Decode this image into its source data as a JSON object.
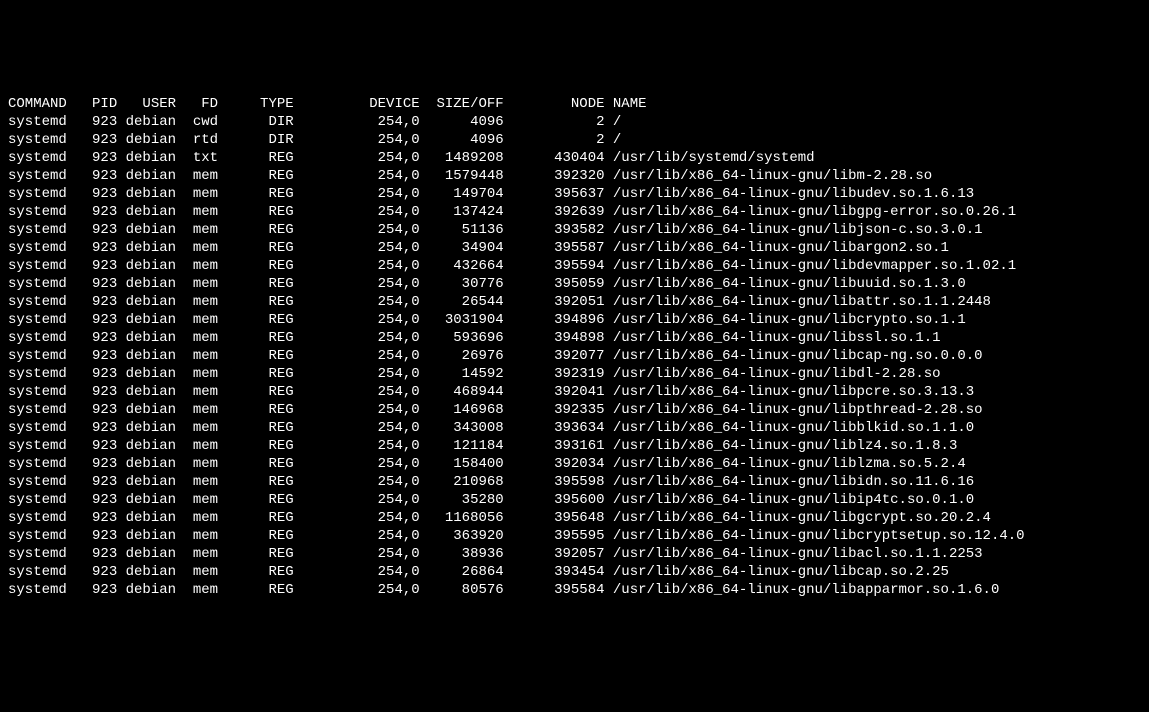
{
  "headers": {
    "command": "COMMAND",
    "pid": "PID",
    "user": "USER",
    "fd": "FD",
    "type": "TYPE",
    "device": "DEVICE",
    "sizeoff": "SIZE/OFF",
    "node": "NODE",
    "name": "NAME"
  },
  "rows": [
    {
      "cmd": "systemd",
      "pid": "923",
      "user": "debian",
      "fd": "cwd",
      "type": "DIR",
      "device": "254,0",
      "sizeoff": "4096",
      "node": "2",
      "name": "/"
    },
    {
      "cmd": "systemd",
      "pid": "923",
      "user": "debian",
      "fd": "rtd",
      "type": "DIR",
      "device": "254,0",
      "sizeoff": "4096",
      "node": "2",
      "name": "/"
    },
    {
      "cmd": "systemd",
      "pid": "923",
      "user": "debian",
      "fd": "txt",
      "type": "REG",
      "device": "254,0",
      "sizeoff": "1489208",
      "node": "430404",
      "name": "/usr/lib/systemd/systemd"
    },
    {
      "cmd": "systemd",
      "pid": "923",
      "user": "debian",
      "fd": "mem",
      "type": "REG",
      "device": "254,0",
      "sizeoff": "1579448",
      "node": "392320",
      "name": "/usr/lib/x86_64-linux-gnu/libm-2.28.so"
    },
    {
      "cmd": "systemd",
      "pid": "923",
      "user": "debian",
      "fd": "mem",
      "type": "REG",
      "device": "254,0",
      "sizeoff": "149704",
      "node": "395637",
      "name": "/usr/lib/x86_64-linux-gnu/libudev.so.1.6.13"
    },
    {
      "cmd": "systemd",
      "pid": "923",
      "user": "debian",
      "fd": "mem",
      "type": "REG",
      "device": "254,0",
      "sizeoff": "137424",
      "node": "392639",
      "name": "/usr/lib/x86_64-linux-gnu/libgpg-error.so.0.26.1"
    },
    {
      "cmd": "systemd",
      "pid": "923",
      "user": "debian",
      "fd": "mem",
      "type": "REG",
      "device": "254,0",
      "sizeoff": "51136",
      "node": "393582",
      "name": "/usr/lib/x86_64-linux-gnu/libjson-c.so.3.0.1"
    },
    {
      "cmd": "systemd",
      "pid": "923",
      "user": "debian",
      "fd": "mem",
      "type": "REG",
      "device": "254,0",
      "sizeoff": "34904",
      "node": "395587",
      "name": "/usr/lib/x86_64-linux-gnu/libargon2.so.1"
    },
    {
      "cmd": "systemd",
      "pid": "923",
      "user": "debian",
      "fd": "mem",
      "type": "REG",
      "device": "254,0",
      "sizeoff": "432664",
      "node": "395594",
      "name": "/usr/lib/x86_64-linux-gnu/libdevmapper.so.1.02.1"
    },
    {
      "cmd": "systemd",
      "pid": "923",
      "user": "debian",
      "fd": "mem",
      "type": "REG",
      "device": "254,0",
      "sizeoff": "30776",
      "node": "395059",
      "name": "/usr/lib/x86_64-linux-gnu/libuuid.so.1.3.0"
    },
    {
      "cmd": "systemd",
      "pid": "923",
      "user": "debian",
      "fd": "mem",
      "type": "REG",
      "device": "254,0",
      "sizeoff": "26544",
      "node": "392051",
      "name": "/usr/lib/x86_64-linux-gnu/libattr.so.1.1.2448"
    },
    {
      "cmd": "systemd",
      "pid": "923",
      "user": "debian",
      "fd": "mem",
      "type": "REG",
      "device": "254,0",
      "sizeoff": "3031904",
      "node": "394896",
      "name": "/usr/lib/x86_64-linux-gnu/libcrypto.so.1.1"
    },
    {
      "cmd": "systemd",
      "pid": "923",
      "user": "debian",
      "fd": "mem",
      "type": "REG",
      "device": "254,0",
      "sizeoff": "593696",
      "node": "394898",
      "name": "/usr/lib/x86_64-linux-gnu/libssl.so.1.1"
    },
    {
      "cmd": "systemd",
      "pid": "923",
      "user": "debian",
      "fd": "mem",
      "type": "REG",
      "device": "254,0",
      "sizeoff": "26976",
      "node": "392077",
      "name": "/usr/lib/x86_64-linux-gnu/libcap-ng.so.0.0.0"
    },
    {
      "cmd": "systemd",
      "pid": "923",
      "user": "debian",
      "fd": "mem",
      "type": "REG",
      "device": "254,0",
      "sizeoff": "14592",
      "node": "392319",
      "name": "/usr/lib/x86_64-linux-gnu/libdl-2.28.so"
    },
    {
      "cmd": "systemd",
      "pid": "923",
      "user": "debian",
      "fd": "mem",
      "type": "REG",
      "device": "254,0",
      "sizeoff": "468944",
      "node": "392041",
      "name": "/usr/lib/x86_64-linux-gnu/libpcre.so.3.13.3"
    },
    {
      "cmd": "systemd",
      "pid": "923",
      "user": "debian",
      "fd": "mem",
      "type": "REG",
      "device": "254,0",
      "sizeoff": "146968",
      "node": "392335",
      "name": "/usr/lib/x86_64-linux-gnu/libpthread-2.28.so"
    },
    {
      "cmd": "systemd",
      "pid": "923",
      "user": "debian",
      "fd": "mem",
      "type": "REG",
      "device": "254,0",
      "sizeoff": "343008",
      "node": "393634",
      "name": "/usr/lib/x86_64-linux-gnu/libblkid.so.1.1.0"
    },
    {
      "cmd": "systemd",
      "pid": "923",
      "user": "debian",
      "fd": "mem",
      "type": "REG",
      "device": "254,0",
      "sizeoff": "121184",
      "node": "393161",
      "name": "/usr/lib/x86_64-linux-gnu/liblz4.so.1.8.3"
    },
    {
      "cmd": "systemd",
      "pid": "923",
      "user": "debian",
      "fd": "mem",
      "type": "REG",
      "device": "254,0",
      "sizeoff": "158400",
      "node": "392034",
      "name": "/usr/lib/x86_64-linux-gnu/liblzma.so.5.2.4"
    },
    {
      "cmd": "systemd",
      "pid": "923",
      "user": "debian",
      "fd": "mem",
      "type": "REG",
      "device": "254,0",
      "sizeoff": "210968",
      "node": "395598",
      "name": "/usr/lib/x86_64-linux-gnu/libidn.so.11.6.16"
    },
    {
      "cmd": "systemd",
      "pid": "923",
      "user": "debian",
      "fd": "mem",
      "type": "REG",
      "device": "254,0",
      "sizeoff": "35280",
      "node": "395600",
      "name": "/usr/lib/x86_64-linux-gnu/libip4tc.so.0.1.0"
    },
    {
      "cmd": "systemd",
      "pid": "923",
      "user": "debian",
      "fd": "mem",
      "type": "REG",
      "device": "254,0",
      "sizeoff": "1168056",
      "node": "395648",
      "name": "/usr/lib/x86_64-linux-gnu/libgcrypt.so.20.2.4"
    },
    {
      "cmd": "systemd",
      "pid": "923",
      "user": "debian",
      "fd": "mem",
      "type": "REG",
      "device": "254,0",
      "sizeoff": "363920",
      "node": "395595",
      "name": "/usr/lib/x86_64-linux-gnu/libcryptsetup.so.12.4.0"
    },
    {
      "cmd": "systemd",
      "pid": "923",
      "user": "debian",
      "fd": "mem",
      "type": "REG",
      "device": "254,0",
      "sizeoff": "38936",
      "node": "392057",
      "name": "/usr/lib/x86_64-linux-gnu/libacl.so.1.1.2253"
    },
    {
      "cmd": "systemd",
      "pid": "923",
      "user": "debian",
      "fd": "mem",
      "type": "REG",
      "device": "254,0",
      "sizeoff": "26864",
      "node": "393454",
      "name": "/usr/lib/x86_64-linux-gnu/libcap.so.2.25"
    },
    {
      "cmd": "systemd",
      "pid": "923",
      "user": "debian",
      "fd": "mem",
      "type": "REG",
      "device": "254,0",
      "sizeoff": "80576",
      "node": "395584",
      "name": "/usr/lib/x86_64-linux-gnu/libapparmor.so.1.6.0"
    }
  ]
}
